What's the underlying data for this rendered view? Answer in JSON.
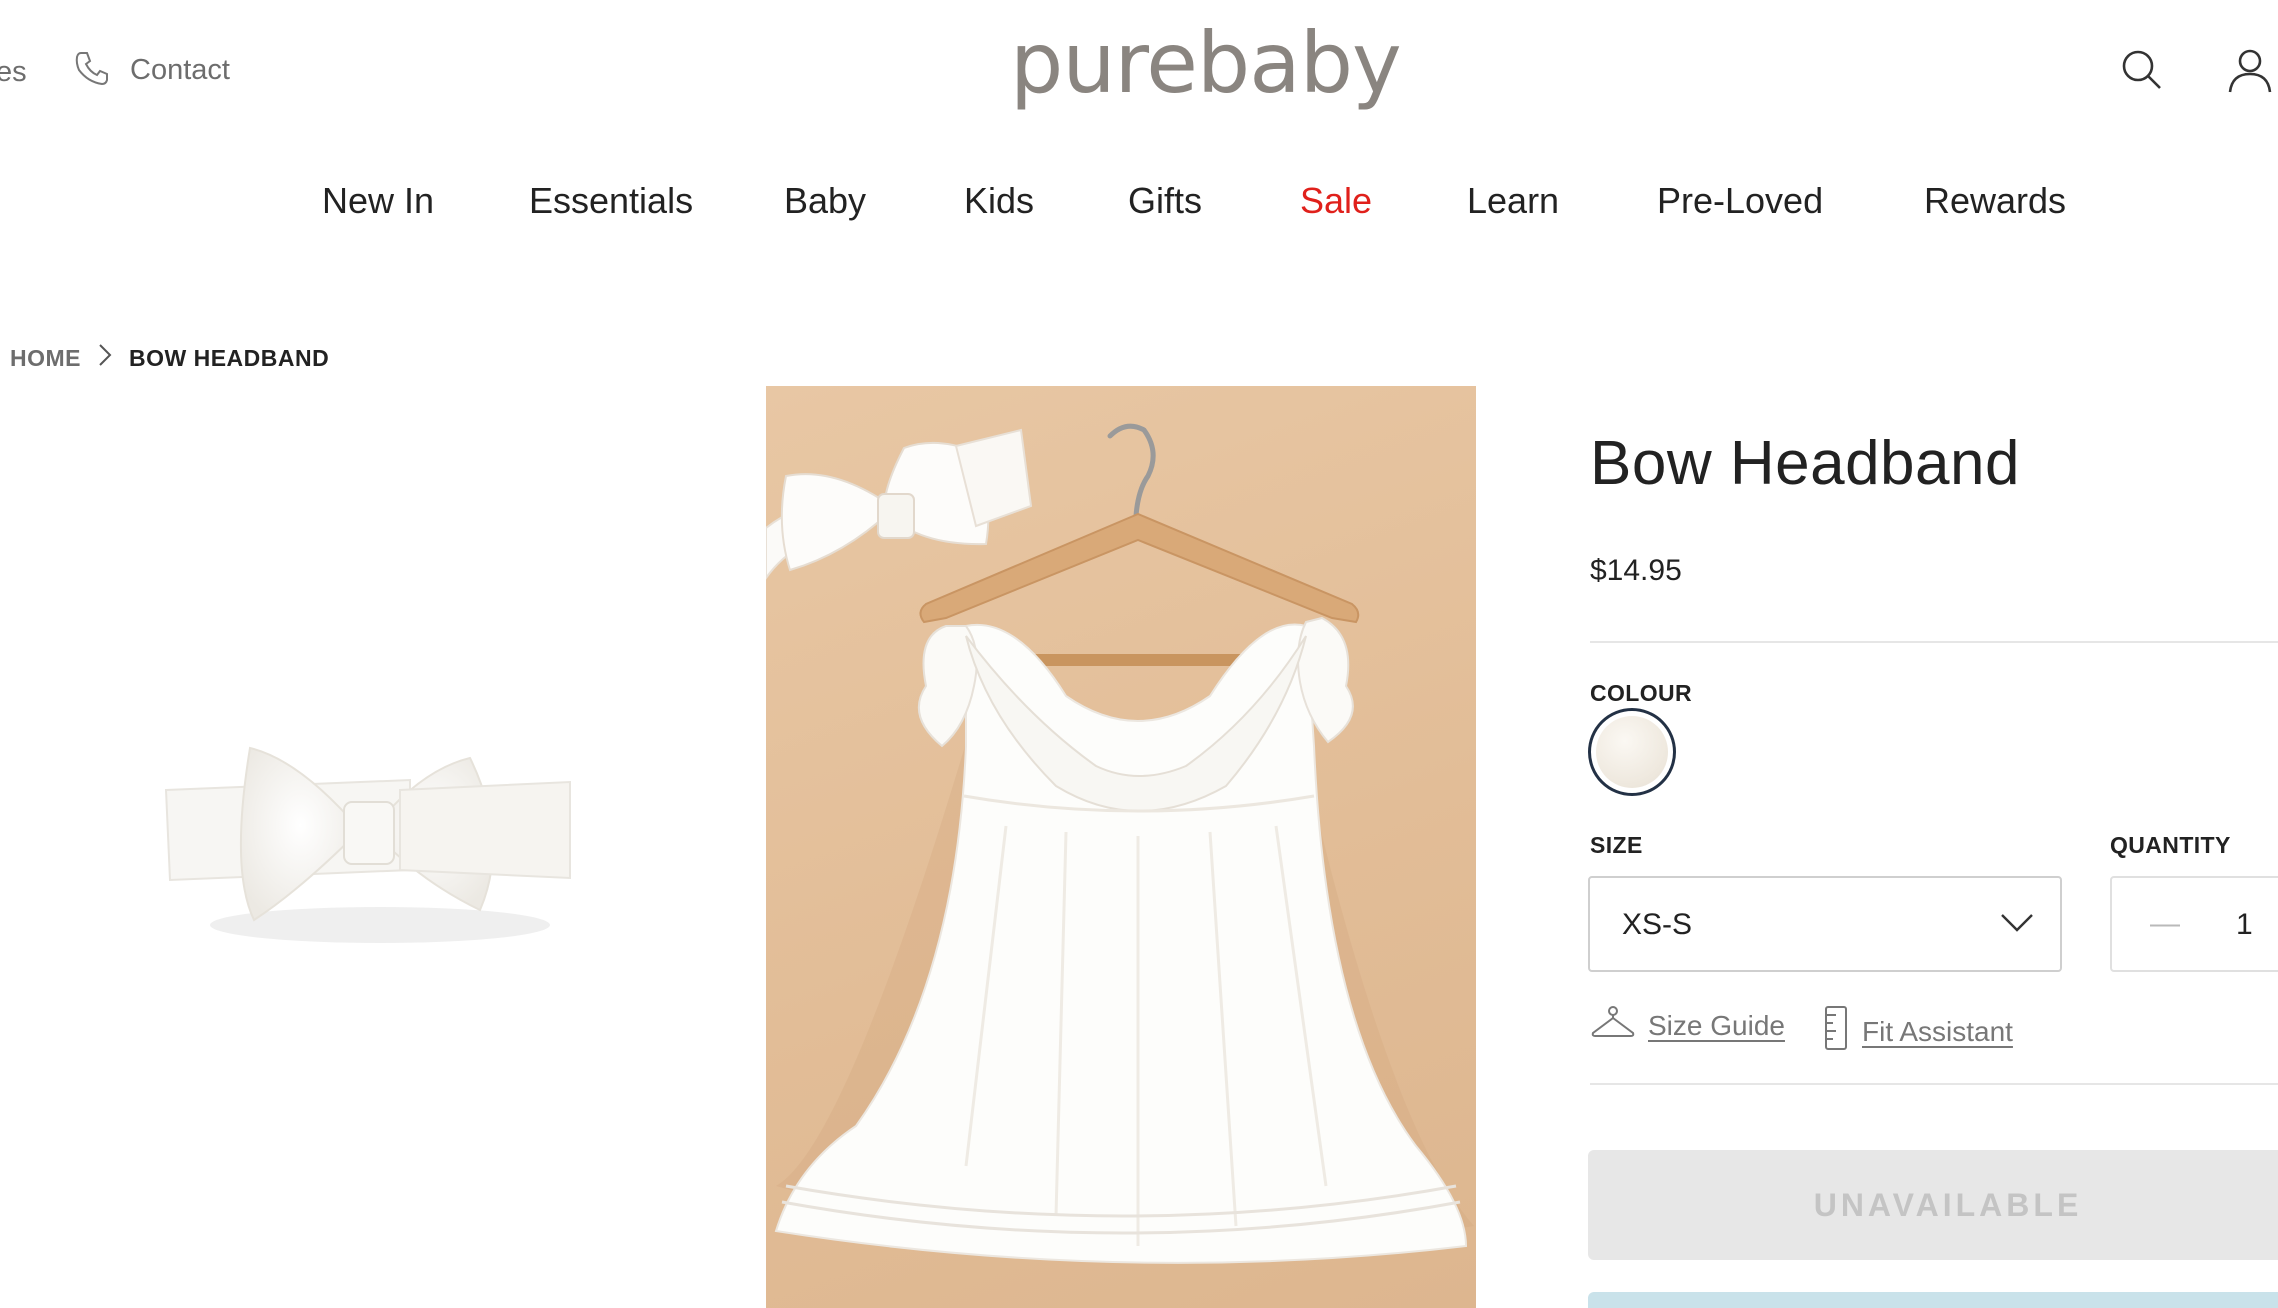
{
  "header": {
    "stores_partial": "es",
    "contact_label": "Contact",
    "logo_text": "purebaby"
  },
  "nav": {
    "items": [
      {
        "label": "New In"
      },
      {
        "label": "Essentials"
      },
      {
        "label": "Baby"
      },
      {
        "label": "Kids"
      },
      {
        "label": "Gifts"
      },
      {
        "label": "Sale",
        "color": "#e0201b"
      },
      {
        "label": "Learn"
      },
      {
        "label": "Pre-Loved"
      },
      {
        "label": "Rewards"
      }
    ]
  },
  "breadcrumb": {
    "home": "HOME",
    "current": "BOW HEADBAND"
  },
  "product": {
    "title": "Bow Headband",
    "price": "$14.95",
    "colour_label": "COLOUR",
    "size_label": "SIZE",
    "size_value": "XS-S",
    "quantity_label": "QUANTITY",
    "quantity_minus": "—",
    "quantity_value": "1",
    "size_guide": "Size Guide",
    "fit_assistant": "Fit Assistant",
    "cta_label": "UNAVAILABLE"
  },
  "colors": {
    "accent_sale": "#e0201b",
    "swatch_border": "#233145",
    "hero_background": "#e2bd97",
    "button_disabled": "#e7e7e7"
  }
}
